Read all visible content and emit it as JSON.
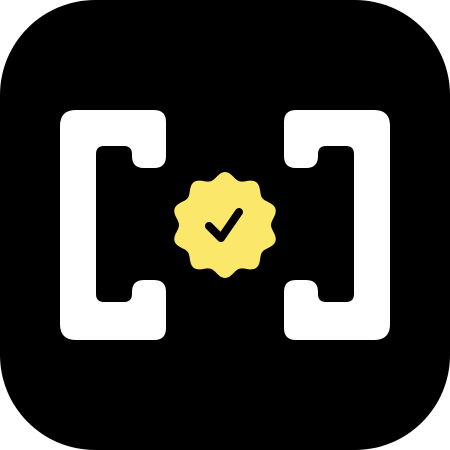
{
  "icon": {
    "name": "verified-scan-app-icon",
    "colors": {
      "background": "#000000",
      "brackets": "#ffffff",
      "badge": "#fbe86a",
      "checkmark": "#000000"
    }
  }
}
